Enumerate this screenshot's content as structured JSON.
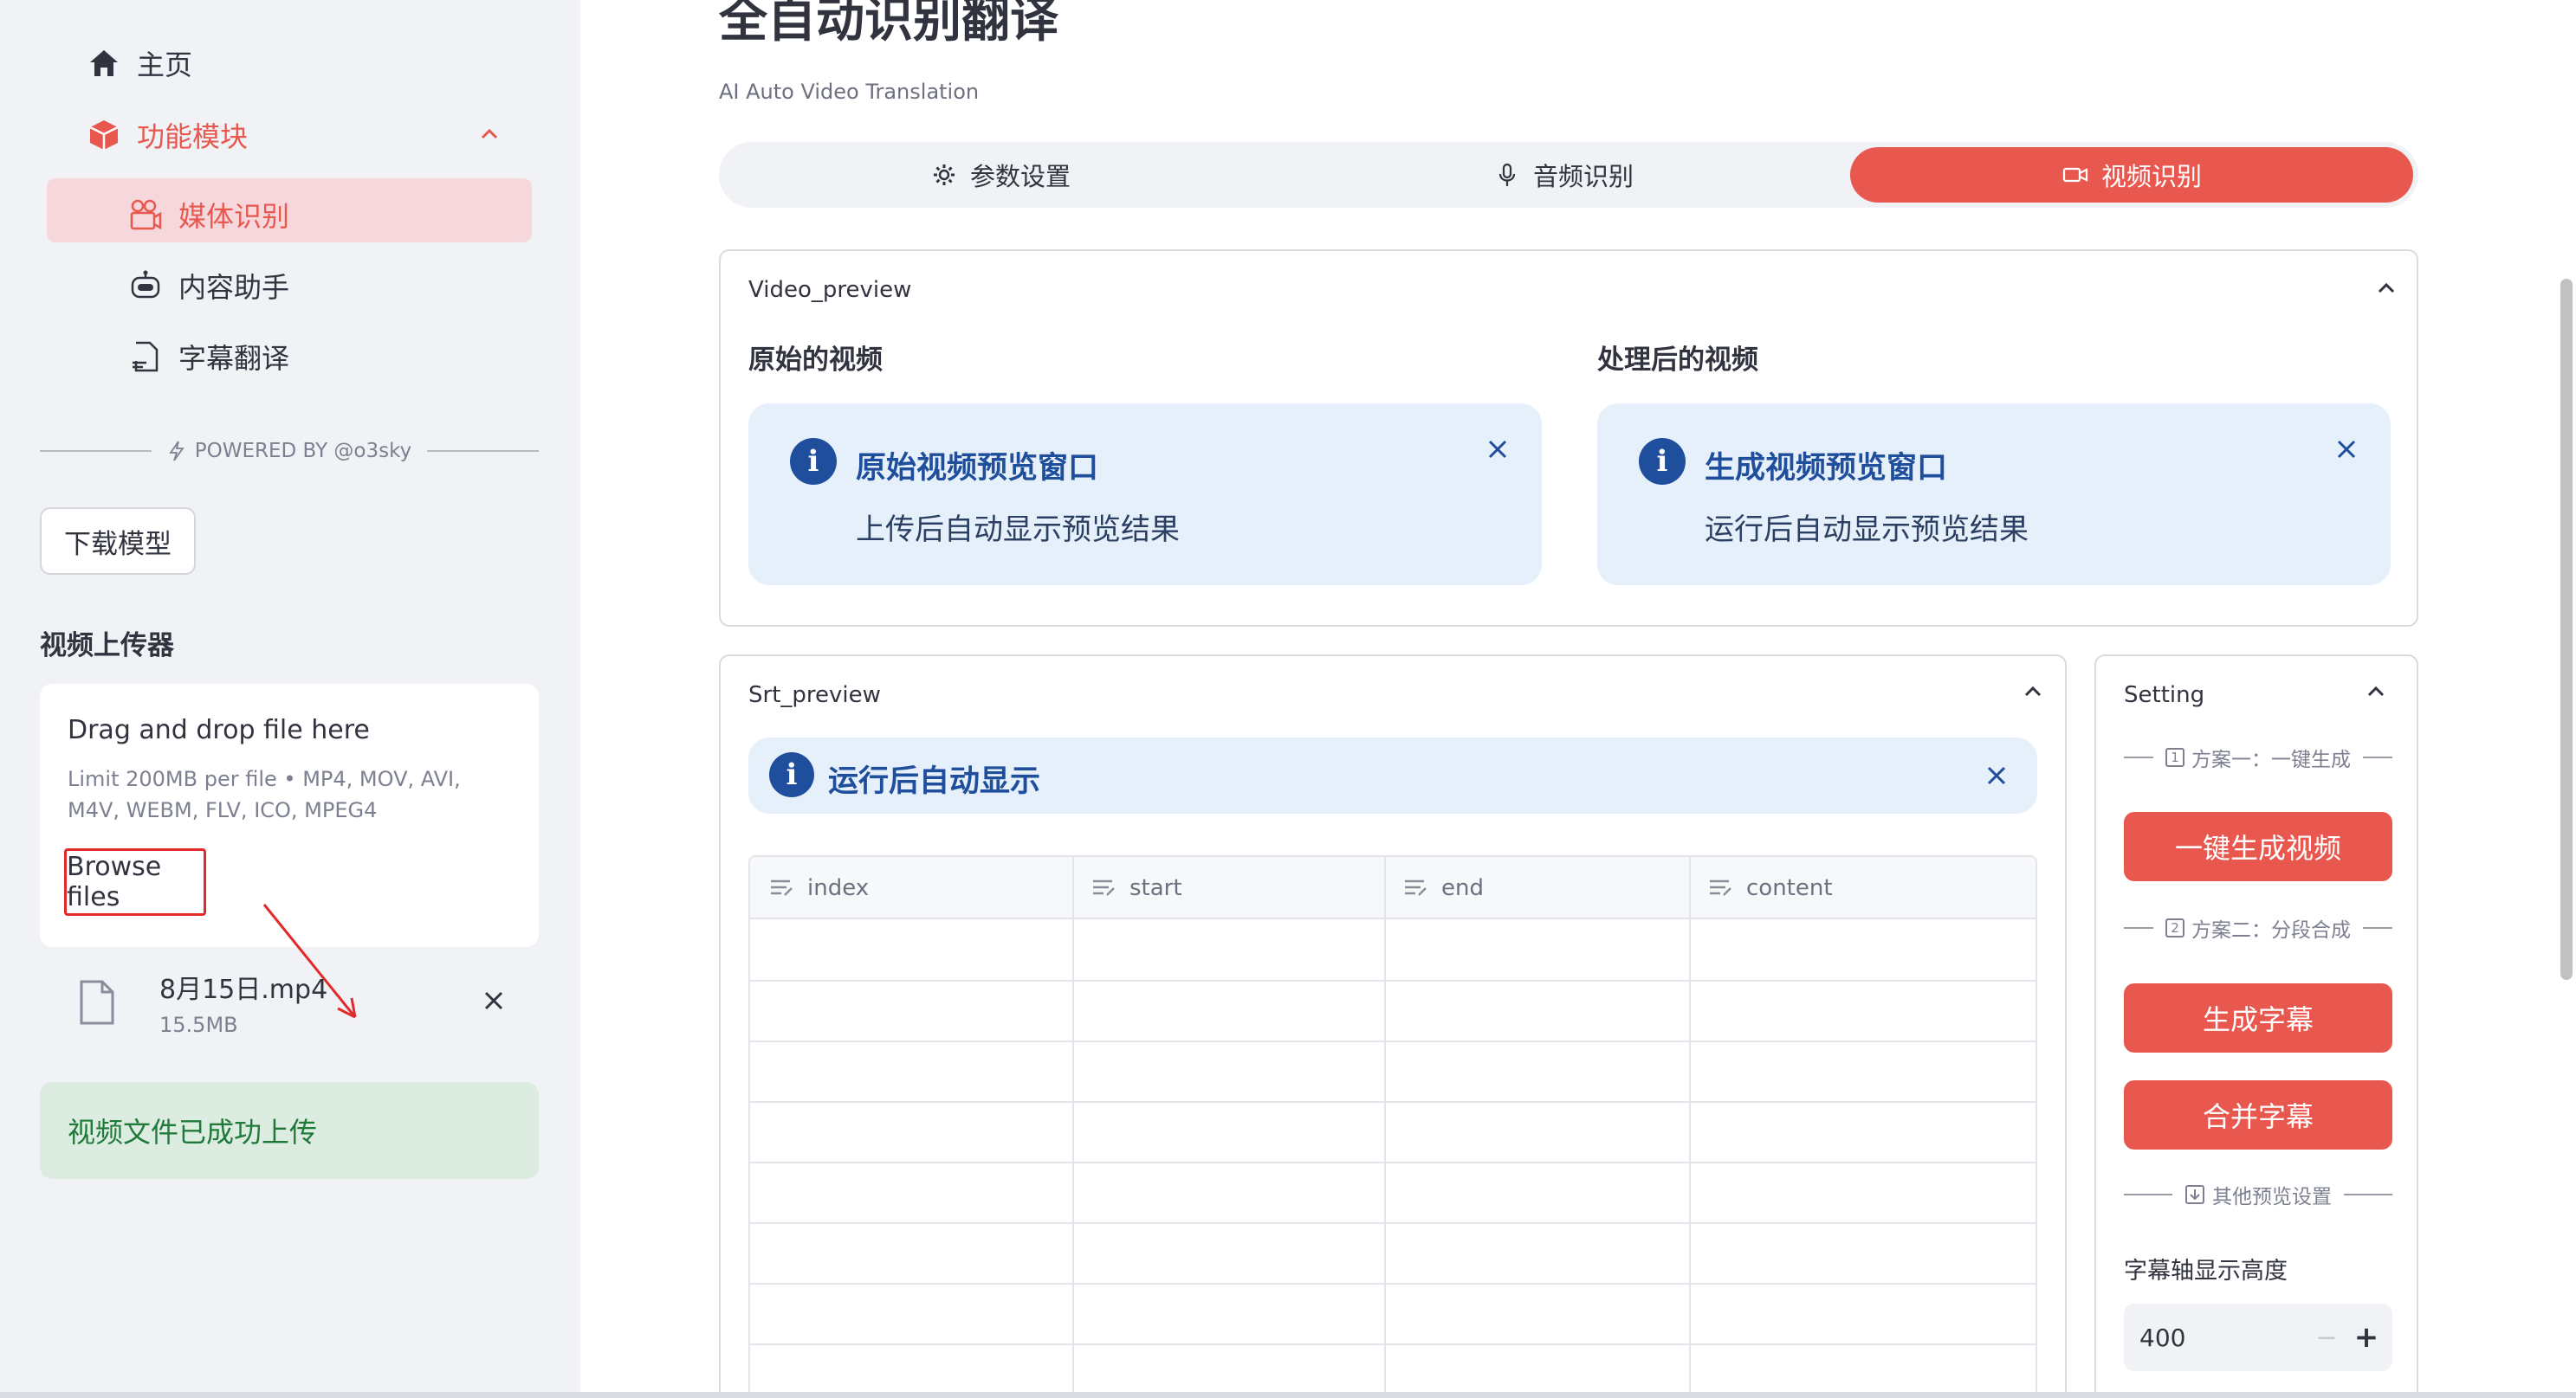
{
  "sidebar": {
    "nav": {
      "home": "主页",
      "modules": "功能模块",
      "media": "媒体识别",
      "assistant": "内容助手",
      "subtitle": "字幕翻译"
    },
    "powered_by": "POWERED BY @o3sky",
    "download_button": "下载模型",
    "uploader_title": "视频上传器",
    "dropzone": {
      "title": "Drag and drop file here",
      "limit": "Limit 200MB per file • MP4, MOV, AVI, M4V, WEBM, FLV, ICO, MPEG4",
      "browse_button": "Browse files"
    },
    "file": {
      "name": "8月15日.mp4",
      "size": "15.5MB"
    },
    "success_message": "视频文件已成功上传"
  },
  "main": {
    "title": "全自动识别翻译",
    "subtitle": "AI Auto Video Translation",
    "tabs": [
      {
        "label": "参数设置",
        "icon": "gear-icon"
      },
      {
        "label": "音频识别",
        "icon": "microphone-icon"
      },
      {
        "label": "视频识别",
        "icon": "video-camera-icon",
        "active": true
      }
    ],
    "video_preview": {
      "label": "Video_preview",
      "original": {
        "heading": "原始的视频",
        "info_title": "原始视频预览窗口",
        "info_desc": "上传后自动显示预览结果"
      },
      "processed": {
        "heading": "处理后的视频",
        "info_title": "生成视频预览窗口",
        "info_desc": "运行后自动显示预览结果"
      }
    },
    "srt_preview": {
      "label": "Srt_preview",
      "info_title": "运行后自动显示",
      "columns": [
        "index",
        "start",
        "end",
        "content"
      ]
    },
    "setting": {
      "label": "Setting",
      "plan1": "方案一：一键生成",
      "plan1_num": "1",
      "btn_one_click": "一键生成视频",
      "plan2": "方案二：分段合成",
      "plan2_num": "2",
      "btn_gen_subtitle": "生成字幕",
      "btn_merge_subtitle": "合并字幕",
      "other": "其他预览设置",
      "height_label": "字幕轴显示高度",
      "height_value": "400",
      "minus": "−",
      "plus": "+"
    }
  },
  "colors": {
    "accent": "#e8584f",
    "info_bg": "#e6f0fb",
    "info_text": "#1f4e9d",
    "success_bg": "#dcece0",
    "success_text": "#1f7a3a",
    "sidebar_bg": "#f0f2f6"
  }
}
